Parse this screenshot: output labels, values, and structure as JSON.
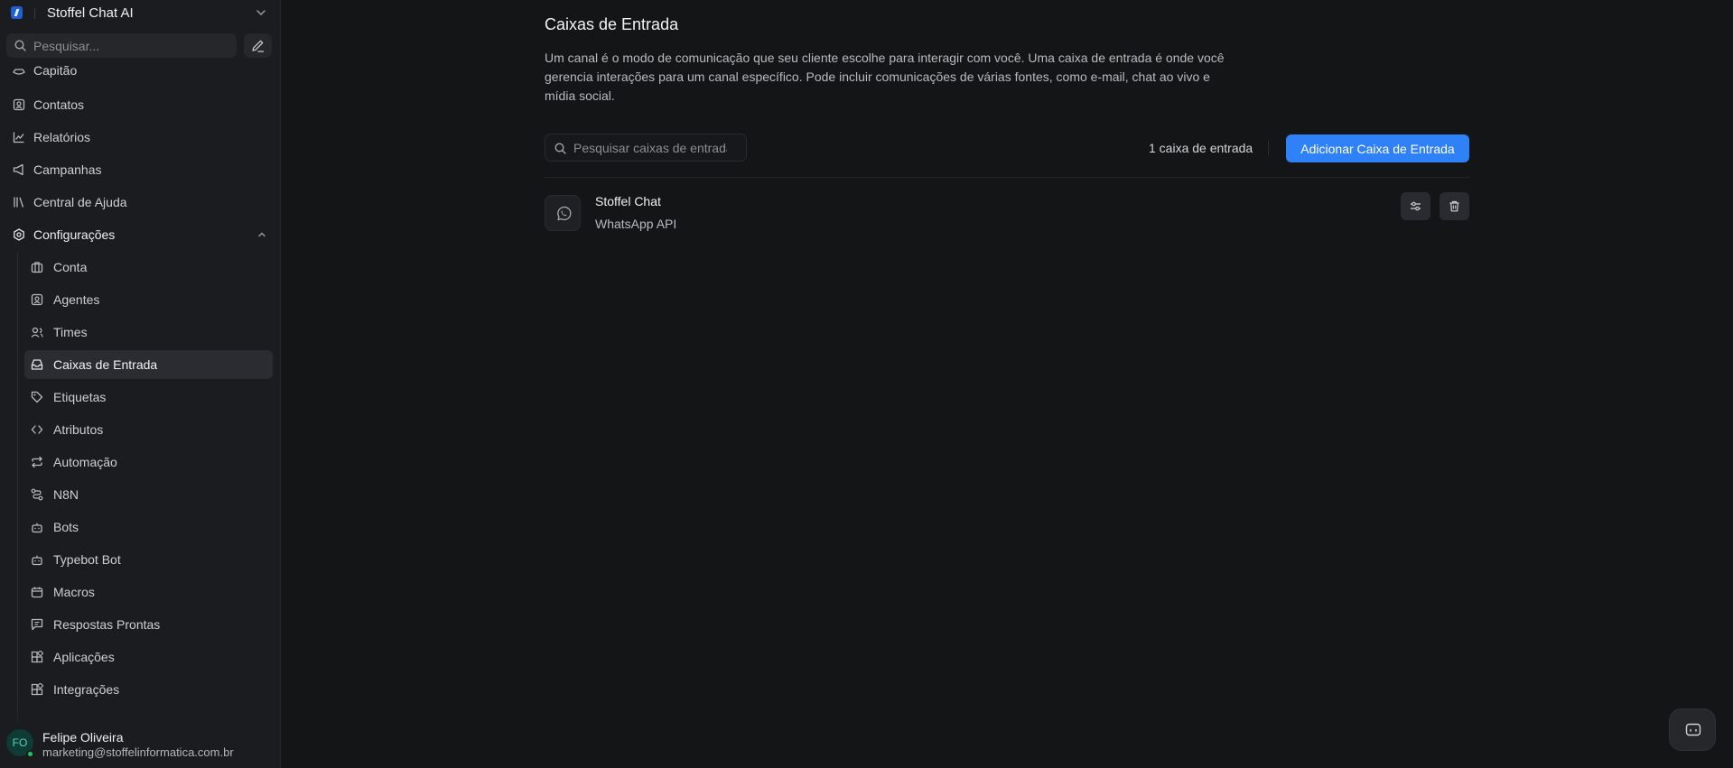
{
  "account": {
    "name": "Stoffel Chat AI"
  },
  "search": {
    "placeholder": "Pesquisar..."
  },
  "nav": {
    "items": [
      {
        "label": "Capitão",
        "icon": "ship-icon"
      },
      {
        "label": "Contatos",
        "icon": "contact-icon"
      },
      {
        "label": "Relatórios",
        "icon": "chart-icon"
      },
      {
        "label": "Campanhas",
        "icon": "megaphone-icon"
      },
      {
        "label": "Central de Ajuda",
        "icon": "library-icon"
      },
      {
        "label": "Configurações",
        "icon": "gear-icon"
      }
    ],
    "settings_items": [
      {
        "label": "Conta",
        "icon": "briefcase-icon"
      },
      {
        "label": "Agentes",
        "icon": "contact-icon"
      },
      {
        "label": "Times",
        "icon": "users-icon"
      },
      {
        "label": "Caixas de Entrada",
        "icon": "inbox-icon",
        "active": true
      },
      {
        "label": "Etiquetas",
        "icon": "tag-icon"
      },
      {
        "label": "Atributos",
        "icon": "code-icon"
      },
      {
        "label": "Automação",
        "icon": "repeat-icon"
      },
      {
        "label": "N8N",
        "icon": "route-icon"
      },
      {
        "label": "Bots",
        "icon": "bot-icon"
      },
      {
        "label": "Typebot Bot",
        "icon": "bot-icon"
      },
      {
        "label": "Macros",
        "icon": "calendar-icon"
      },
      {
        "label": "Respostas Prontas",
        "icon": "message-square-icon"
      },
      {
        "label": "Aplicações",
        "icon": "apps-icon"
      },
      {
        "label": "Integrações",
        "icon": "apps-icon"
      }
    ]
  },
  "user": {
    "initials": "FO",
    "name": "Felipe Oliveira",
    "email": "marketing@stoffelinformatica.com.br"
  },
  "page": {
    "title": "Caixas de Entrada",
    "description": "Um canal é o modo de comunicação que seu cliente escolhe para interagir com você. Uma caixa de entrada é onde você gerencia interações para um canal específico. Pode incluir comunicações de várias fontes, como e-mail, chat ao vivo e mídia social.",
    "search_placeholder": "Pesquisar caixas de entrada",
    "count_label": "1 caixa de entrada",
    "add_button": "Adicionar Caixa de Entrada"
  },
  "inboxes": [
    {
      "name": "Stoffel Chat",
      "channel": "WhatsApp API",
      "icon": "whatsapp-icon"
    }
  ],
  "colors": {
    "accent": "#2f81f7",
    "background": "#141517",
    "sidebar": "#1b1c1f"
  }
}
